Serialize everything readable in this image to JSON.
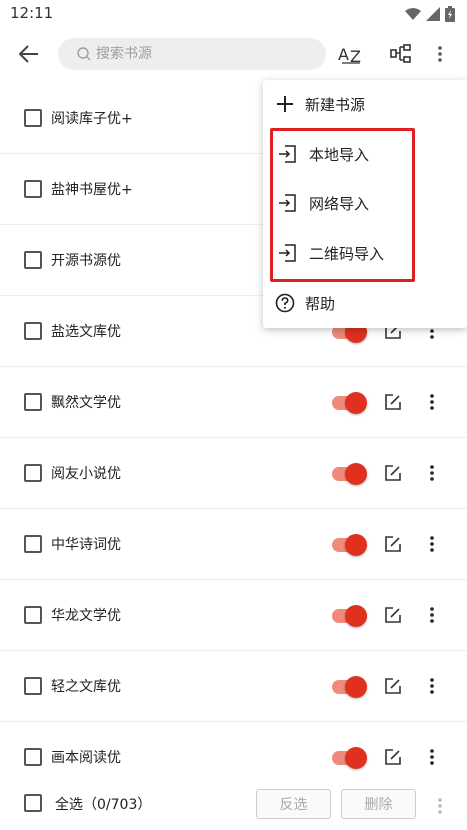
{
  "status_bar": {
    "time": "12:11"
  },
  "toolbar": {
    "search_placeholder": "搜索书源",
    "sort_icon": "az-sort-icon",
    "group_icon": "group-icon",
    "more_icon": "more-vert-icon"
  },
  "sources": [
    {
      "name": "阅读库子优+",
      "enabled": true
    },
    {
      "name": "盐神书屋优+",
      "enabled": true
    },
    {
      "name": "开源书源优",
      "enabled": true
    },
    {
      "name": "盐选文库优",
      "enabled": true
    },
    {
      "name": "飘然文学优",
      "enabled": true
    },
    {
      "name": "阅友小说优",
      "enabled": true
    },
    {
      "name": "中华诗词优",
      "enabled": true
    },
    {
      "name": "华龙文学优",
      "enabled": true
    },
    {
      "name": "轻之文库优",
      "enabled": true
    },
    {
      "name": "画本阅读优",
      "enabled": true
    }
  ],
  "menu": {
    "new_source": "新建书源",
    "local_import": "本地导入",
    "network_import": "网络导入",
    "qr_import": "二维码导入",
    "help": "帮助"
  },
  "bottom_bar": {
    "select_all": "全选（0/703）",
    "invert": "反选",
    "delete": "删除"
  },
  "colors": {
    "accent": "#e0301e",
    "highlight": "#e02020"
  }
}
